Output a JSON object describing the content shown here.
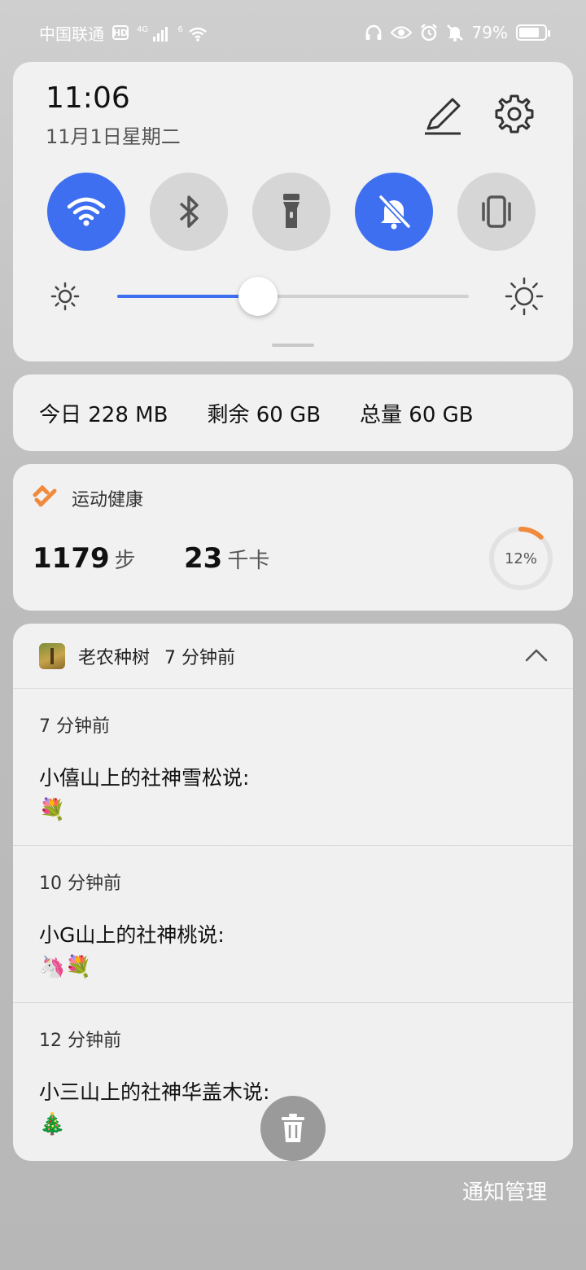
{
  "status_bar": {
    "carrier": "中国联通",
    "hd": "HD",
    "network": "4G",
    "wifi_sup": "6",
    "battery_percent": "79%",
    "battery_level": 0.79
  },
  "quick_settings": {
    "time": "11:06",
    "date": "11月1日星期二",
    "toggles": [
      {
        "name": "wifi",
        "on": true
      },
      {
        "name": "bluetooth",
        "on": false
      },
      {
        "name": "flashlight",
        "on": false
      },
      {
        "name": "silent",
        "on": true
      },
      {
        "name": "vibrate",
        "on": false
      }
    ],
    "brightness_level": 0.4
  },
  "data_usage": {
    "today": "今日 228 MB",
    "remaining": "剩余 60 GB",
    "total": "总量 60 GB"
  },
  "health": {
    "title": "运动健康",
    "steps": "1179",
    "steps_unit": "步",
    "calories": "23",
    "calories_unit": "千卡",
    "progress_label": "12%",
    "progress": 0.12,
    "accent": "#f08a3c"
  },
  "notifications": {
    "app_name": "老农种树",
    "time": "7 分钟前",
    "items": [
      {
        "when": "7 分钟前",
        "title": "小僖山上的社神雪松说:",
        "emoji": "💐"
      },
      {
        "when": "10 分钟前",
        "title": "小G山上的社神桃说:",
        "emoji": "🦄💐"
      },
      {
        "when": "12 分钟前",
        "title": "小三山上的社神华盖木说:",
        "emoji": "🎄"
      }
    ]
  },
  "footer": {
    "manage": "通知管理"
  },
  "colors": {
    "accent": "#3d6ff0",
    "toggle_off": "#d6d6d6"
  }
}
